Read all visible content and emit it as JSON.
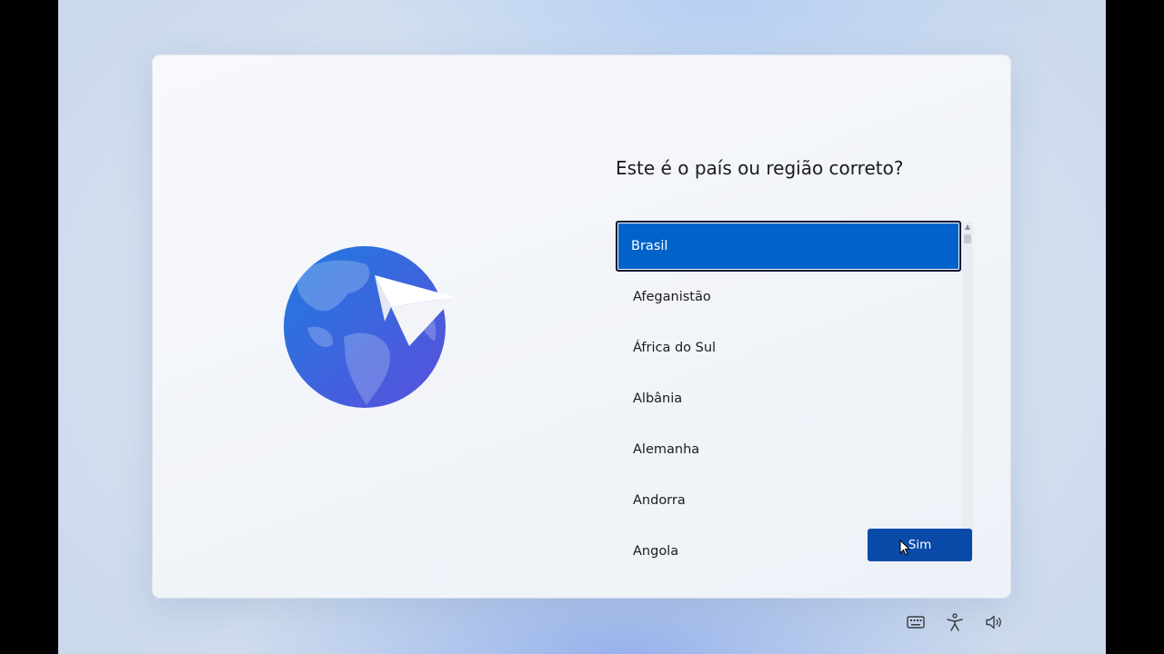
{
  "dialog": {
    "title": "Este é o país ou região correto?",
    "countries": [
      {
        "label": "Brasil",
        "selected": true
      },
      {
        "label": "Afeganistão",
        "selected": false
      },
      {
        "label": "África do Sul",
        "selected": false
      },
      {
        "label": "Albânia",
        "selected": false
      },
      {
        "label": "Alemanha",
        "selected": false
      },
      {
        "label": "Andorra",
        "selected": false
      },
      {
        "label": "Angola",
        "selected": false
      }
    ],
    "yes_button": "Sim"
  },
  "taskbar": {
    "icons": [
      "keyboard-icon",
      "accessibility-icon",
      "volume-icon"
    ]
  },
  "colors": {
    "accent": "#0162c9",
    "button": "#0a4aa8",
    "background": "#dfe8f4"
  }
}
